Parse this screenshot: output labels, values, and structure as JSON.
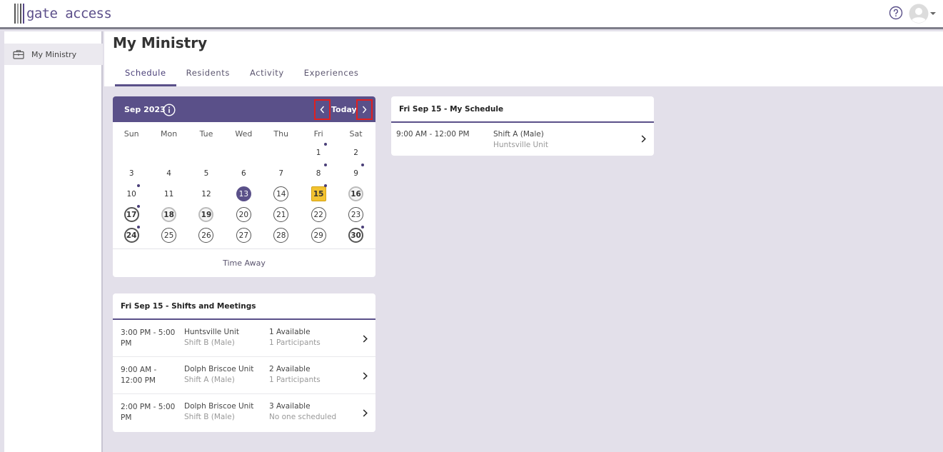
{
  "app": {
    "logo_text": "gate access"
  },
  "header": {
    "help_icon": "question-circle-icon",
    "avatar_icon": "user-avatar-icon"
  },
  "sidebar": {
    "items": [
      {
        "label": "My Ministry",
        "icon": "briefcase-icon"
      }
    ]
  },
  "page": {
    "title": "My Ministry",
    "tabs": [
      {
        "label": "Schedule",
        "active": true
      },
      {
        "label": "Residents",
        "active": false
      },
      {
        "label": "Activity",
        "active": false
      },
      {
        "label": "Experiences",
        "active": false
      }
    ]
  },
  "calendar": {
    "month_label": "Sep 2023",
    "today_label": "Today",
    "weekdays": [
      "Sun",
      "Mon",
      "Tue",
      "Wed",
      "Thu",
      "Fri",
      "Sat"
    ],
    "first_weekday_index": 5,
    "days": [
      {
        "n": "1",
        "style": "plain",
        "dot": true
      },
      {
        "n": "2",
        "style": "plain",
        "dot": false
      },
      {
        "n": "3",
        "style": "plain",
        "dot": false
      },
      {
        "n": "4",
        "style": "plain",
        "dot": false
      },
      {
        "n": "5",
        "style": "plain",
        "dot": false
      },
      {
        "n": "6",
        "style": "plain",
        "dot": false
      },
      {
        "n": "7",
        "style": "plain",
        "dot": false
      },
      {
        "n": "8",
        "style": "plain",
        "dot": true
      },
      {
        "n": "9",
        "style": "plain",
        "dot": true
      },
      {
        "n": "10",
        "style": "plain",
        "dot": true
      },
      {
        "n": "11",
        "style": "plain",
        "dot": false
      },
      {
        "n": "12",
        "style": "plain",
        "dot": false
      },
      {
        "n": "13",
        "style": "filled",
        "dot": false
      },
      {
        "n": "14",
        "style": "ring",
        "dot": false
      },
      {
        "n": "15",
        "style": "today",
        "dot": true
      },
      {
        "n": "16",
        "style": "grey",
        "dot": false
      },
      {
        "n": "17",
        "style": "ring-bold",
        "dot": true
      },
      {
        "n": "18",
        "style": "grey",
        "dot": false
      },
      {
        "n": "19",
        "style": "grey",
        "dot": false
      },
      {
        "n": "20",
        "style": "ring",
        "dot": false
      },
      {
        "n": "21",
        "style": "ring",
        "dot": false
      },
      {
        "n": "22",
        "style": "ring",
        "dot": false
      },
      {
        "n": "23",
        "style": "ring",
        "dot": false
      },
      {
        "n": "24",
        "style": "ring-bold",
        "dot": true
      },
      {
        "n": "25",
        "style": "ring",
        "dot": false
      },
      {
        "n": "26",
        "style": "ring",
        "dot": false
      },
      {
        "n": "27",
        "style": "ring",
        "dot": false
      },
      {
        "n": "28",
        "style": "ring",
        "dot": false
      },
      {
        "n": "29",
        "style": "ring",
        "dot": false
      },
      {
        "n": "30",
        "style": "ring-bold",
        "dot": true
      }
    ],
    "time_away_label": "Time Away"
  },
  "my_schedule": {
    "title": "Fri Sep 15 - My Schedule",
    "rows": [
      {
        "time": "9:00 AM - 12:00 PM",
        "title": "Shift A (Male)",
        "subtitle": "Huntsville Unit"
      }
    ]
  },
  "shifts": {
    "title": "Fri Sep 15 - Shifts and Meetings",
    "rows": [
      {
        "time": "3:00 PM - 5:00 PM",
        "unit": "Huntsville Unit",
        "shift": "Shift B (Male)",
        "available": "1 Available",
        "participants": "1 Participants"
      },
      {
        "time": "9:00 AM - 12:00 PM",
        "unit": "Dolph Briscoe Unit",
        "shift": "Shift A (Male)",
        "available": "2 Available",
        "participants": "1 Participants"
      },
      {
        "time": "2:00 PM - 5:00 PM",
        "unit": "Dolph Briscoe Unit",
        "shift": "Shift B (Male)",
        "available": "3 Available",
        "participants": "No one scheduled"
      }
    ]
  },
  "colors": {
    "primary": "#5a5089",
    "today_highlight": "#f2c230",
    "nav_outline": "#e02020",
    "background": "#e3e0ea"
  }
}
